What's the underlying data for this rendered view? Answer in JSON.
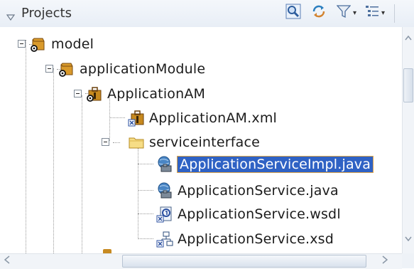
{
  "header": {
    "title": "Projects",
    "toolbar_icons": [
      "find-icon",
      "sync-icon",
      "filter-icon",
      "tree-options-icon"
    ],
    "filter_dropdown": "▾",
    "options_dropdown": "▾"
  },
  "tree": {
    "nodes": [
      {
        "label": "model",
        "icon": "project-icon",
        "expanded": true,
        "level": 0
      },
      {
        "label": "applicationModule",
        "icon": "package-icon",
        "expanded": true,
        "level": 1
      },
      {
        "label": "ApplicationAM",
        "icon": "application-module-icon",
        "expanded": true,
        "level": 2
      },
      {
        "label": "ApplicationAM.xml",
        "icon": "xml-file-icon",
        "level": 3
      },
      {
        "label": "serviceinterface",
        "icon": "folder-icon",
        "expanded": true,
        "level": 3
      },
      {
        "label": "ApplicationServiceImpl.java",
        "icon": "java-service-icon",
        "level": 4,
        "selected": true
      },
      {
        "label": "ApplicationService.java",
        "icon": "java-service-icon",
        "level": 4
      },
      {
        "label": "ApplicationService.wsdl",
        "icon": "wsdl-file-icon",
        "level": 4
      },
      {
        "label": "ApplicationService.xsd",
        "icon": "xsd-file-icon",
        "level": 4
      }
    ]
  },
  "colors": {
    "selection": "#2f62c4",
    "selection_border": "#e1a64a",
    "header_bg": "#eaf0f7"
  }
}
